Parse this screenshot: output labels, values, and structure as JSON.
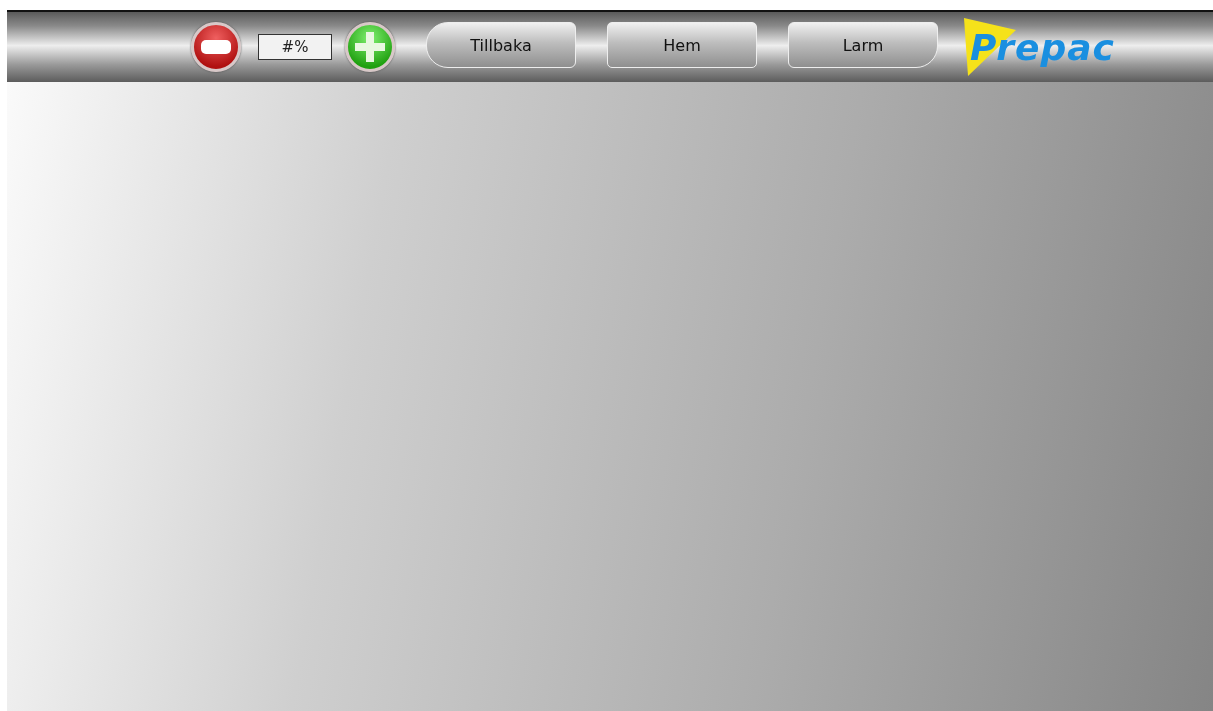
{
  "toolbar": {
    "zoom_value": "#%",
    "buttons": [
      "Tillbaka",
      "Hem",
      "Larm"
    ],
    "logo": "Prepac"
  }
}
